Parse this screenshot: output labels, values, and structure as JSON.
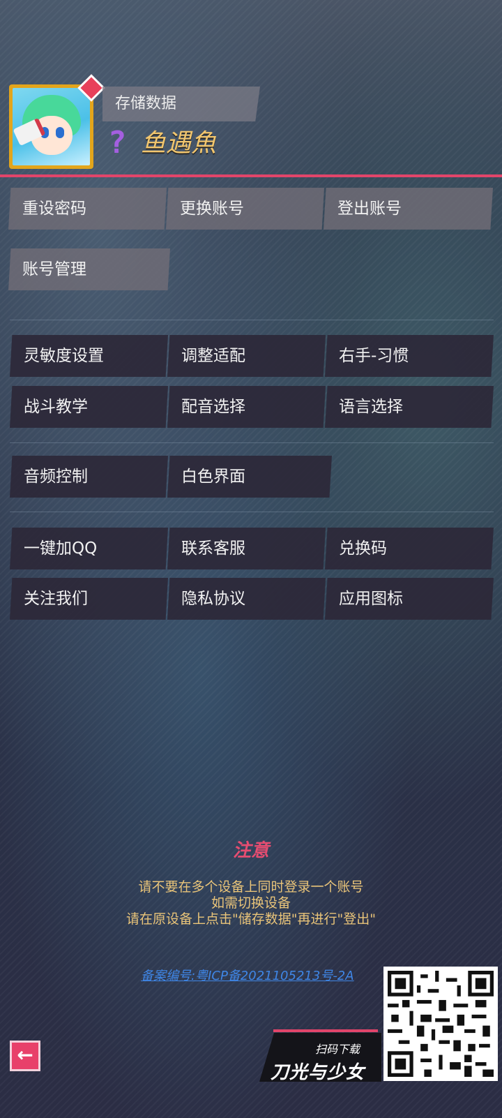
{
  "header": {
    "save_label": "存储数据",
    "username": "鱼遇魚",
    "level_glyph": "?"
  },
  "account_buttons": [
    {
      "label": "重设密码"
    },
    {
      "label": "更换账号"
    },
    {
      "label": "登出账号"
    },
    {
      "label": "账号管理"
    }
  ],
  "settings_buttons": [
    {
      "label": "灵敏度设置"
    },
    {
      "label": "调整适配"
    },
    {
      "label": "右手-习惯"
    },
    {
      "label": "战斗教学"
    },
    {
      "label": "配音选择"
    },
    {
      "label": "语言选择"
    }
  ],
  "ui_buttons": [
    {
      "label": "音频控制"
    },
    {
      "label": "白色界面"
    }
  ],
  "social_buttons": [
    {
      "label": "一键加QQ"
    },
    {
      "label": "联系客服"
    },
    {
      "label": "兑换码"
    },
    {
      "label": "关注我们"
    },
    {
      "label": "隐私协议"
    },
    {
      "label": "应用图标"
    }
  ],
  "notice": {
    "title": "注意",
    "lines": [
      "请不要在多个设备上同时登录一个账号",
      "如需切换设备",
      "请在原设备上点击\"储存数据\"再进行\"登出\""
    ]
  },
  "icp": "备案编号:粤ICP备2021105213号-2A",
  "download": {
    "scan_label": "扫码下载",
    "game_name": "刀光与少女"
  },
  "colors": {
    "accent": "#e2456a",
    "username": "#f2c66e",
    "notice_title": "#e64d71",
    "notice_text": "#e9c479",
    "link": "#3f86e6"
  }
}
